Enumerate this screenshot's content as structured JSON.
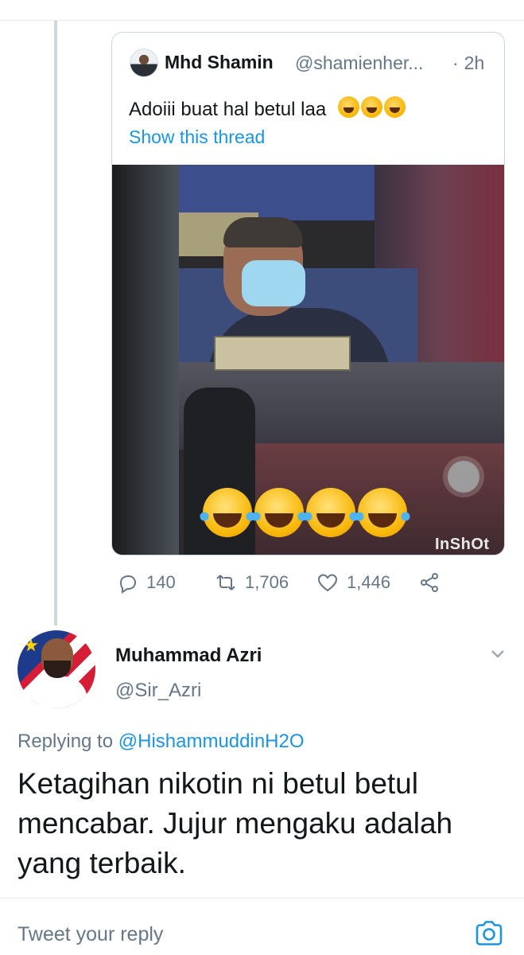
{
  "quoted_tweet": {
    "author_name": "Mhd Shamin",
    "author_handle": "@shamienher...",
    "time": "2h",
    "text": "Adoiii buat hal betul laa",
    "emoji_name": "face-with-tears-of-joy",
    "show_thread": "Show this thread",
    "video_watermark": "InShOt"
  },
  "actions": {
    "replies": "140",
    "retweets": "1,706",
    "likes": "1,446"
  },
  "reply": {
    "author_name": "Muhammad Azri",
    "author_handle": "@Sir_Azri",
    "replying_prefix": "Replying to",
    "replying_to": "@HishammuddinH2O",
    "text": "Ketagihan nikotin ni betul betul mencabar. Jujur mengaku adalah yang terbaik."
  },
  "composer": {
    "placeholder": "Tweet your reply"
  },
  "colors": {
    "link": "#1b95e0",
    "secondary_text": "#657786",
    "primary_text": "#14171a"
  }
}
